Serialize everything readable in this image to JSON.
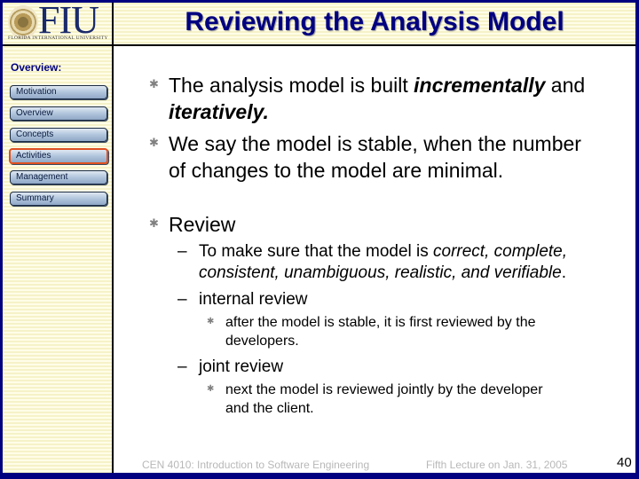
{
  "header": {
    "logo_text": "FIU",
    "logo_subtext": "FLORIDA INTERNATIONAL UNIVERSITY",
    "title": "Reviewing the Analysis Model"
  },
  "sidebar": {
    "title": "Overview:",
    "items": [
      {
        "label": "Motivation",
        "active": false
      },
      {
        "label": "Overview",
        "active": false
      },
      {
        "label": "Concepts",
        "active": false
      },
      {
        "label": "Activities",
        "active": true
      },
      {
        "label": "Management",
        "active": false
      },
      {
        "label": "Summary",
        "active": false
      }
    ],
    "active_color": "#e05020"
  },
  "content": {
    "bullets": [
      {
        "parts": [
          {
            "text": "The analysis model is built ",
            "style": "normal"
          },
          {
            "text": "incrementally",
            "style": "bold-italic"
          },
          {
            "text": " and",
            "style": "normal"
          }
        ],
        "line2_parts": [
          {
            "text": "iteratively.",
            "style": "bold-italic"
          }
        ]
      },
      {
        "line1": "We say the model is stable, when the number",
        "line2": "of changes to the model are minimal."
      },
      {
        "line1": "Review"
      }
    ],
    "review_sub": [
      {
        "line1_prefix": "To make sure that the model is ",
        "line1_italic": "correct, complete,",
        "line2_italic": "consistent, unambiguous, realistic, and verifiable",
        "line2_suffix": "."
      },
      {
        "line1": "internal review",
        "child_line1": "after the model is stable, it is first reviewed by the",
        "child_line2": "developers."
      },
      {
        "line1": "joint review",
        "child_line1": "next the model is reviewed jointly by the developer",
        "child_line2": "and the client."
      }
    ],
    "bullet_glyph": "✱",
    "dash_glyph": "–"
  },
  "footer": {
    "course": "CEN 4010: Introduction to Software Engineering",
    "lecture": "Fifth Lecture on Jan. 31, 2005",
    "page_number": "40"
  },
  "colors": {
    "frame": "#000080",
    "title": "#000080",
    "stripe_a": "#f6f2c8",
    "stripe_b": "#fffde8"
  }
}
